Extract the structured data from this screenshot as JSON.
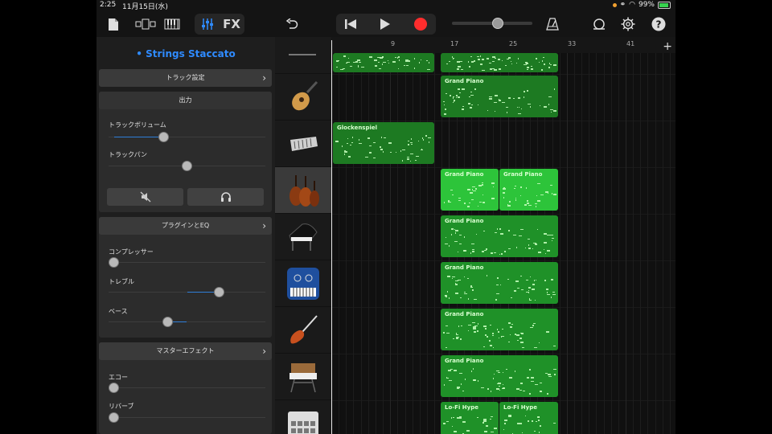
{
  "status": {
    "time": "2:25",
    "date": "11月15日(水)",
    "battery": "99%"
  },
  "toolbar": {
    "fx_label": "FX"
  },
  "panel": {
    "title": "• Strings Staccato",
    "track_settings": "トラック設定",
    "output_header": "出力",
    "volume_label": "トラックボリューム",
    "pan_label": "トラックパン",
    "plugins_eq": "プラグインとEQ",
    "compressor_label": "コンプレッサー",
    "treble_label": "トレブル",
    "bass_label": "ベース",
    "master_effects": "マスターエフェクト",
    "echo_label": "エコー",
    "reverb_label": "リバーブ",
    "levels": {
      "volume": 0.34,
      "pan": 0.5,
      "compressor": 0.0,
      "treble": 0.72,
      "bass": 0.37,
      "echo": 0.0,
      "reverb": 0.0
    }
  },
  "ruler": {
    "marks": [
      "9",
      "17",
      "25",
      "33",
      "41"
    ]
  },
  "tracks": [
    {
      "icon": "guitar-icon"
    },
    {
      "icon": "glockenspiel-icon"
    },
    {
      "icon": "strings-icon",
      "selected": true
    },
    {
      "icon": "grand-piano-icon"
    },
    {
      "icon": "synth-keyboard-icon"
    },
    {
      "icon": "bass-guitar-icon"
    },
    {
      "icon": "synthesizer-icon"
    },
    {
      "icon": "drum-machine-icon"
    }
  ],
  "regions": {
    "r1": "Grand Piano",
    "r2": "Glockenspiel",
    "r3": "Grand Piano",
    "r4": "Grand Piano",
    "r5": "Grand Piano",
    "r6": "Grand Piano",
    "r7": "Grand Piano",
    "r8": "Grand Piano",
    "r9": "Lo-Fi Hype",
    "r10": "Lo-Fi Hype"
  },
  "colors": {
    "accent": "#2f8bff",
    "record": "#ff2d2d",
    "region": "#1f9128",
    "region_selected": "#2dc43a"
  }
}
